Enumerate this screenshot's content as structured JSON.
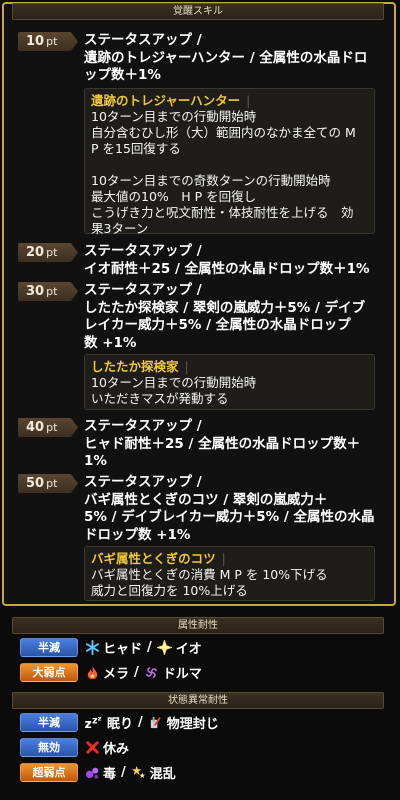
{
  "awakening": {
    "header": "覚醒スキル",
    "entries": [
      {
        "pt": "10",
        "unit": "pt",
        "text": "ステータスアップ /\n遺跡のトレジャーハンター / 全属性の水晶ドロ\nップ数＋1%"
      },
      {
        "pt": "20",
        "unit": "pt",
        "text": "ステータスアップ /\nイオ耐性＋25 / 全属性の水晶ドロップ数＋1%"
      },
      {
        "pt": "30",
        "unit": "pt",
        "text": "ステータスアップ /\nしたたか探検家 / 翠剣の嵐威力＋5% / デイブ\nレイカー威力＋5% / 全属性の水晶ドロップ\n数 +1%"
      },
      {
        "pt": "40",
        "unit": "pt",
        "text": "ステータスアップ /\nヒャド耐性＋25 / 全属性の水晶ドロップ数＋\n1%"
      },
      {
        "pt": "50",
        "unit": "pt",
        "text": "ステータスアップ /\nバギ属性とくぎのコツ / 翠剣の嵐威力＋\n5% / デイブレイカー威力＋5% / 全属性の水晶\nドロップ数 +1%"
      }
    ],
    "details": [
      {
        "title": "遺跡のトレジャーハンター",
        "lines": [
          "10ターン目までの行動開始時",
          "自分含むひし形（大）範囲内のなかま全ての M",
          "P を15回復する",
          "",
          "10ターン目までの奇数ターンの行動開始時",
          "最大値の10%　H P を回復し",
          "こうげき力と呪文耐性・体技耐性を上げる　効",
          "果3ターン"
        ]
      },
      {
        "title": "したたか探検家",
        "lines": [
          "10ターン目までの行動開始時",
          "いただきマスが発動する"
        ]
      },
      {
        "title": "バギ属性とくぎのコツ",
        "lines": [
          "バギ属性とくぎの消費 M P を 10%下げる",
          "威力と回復力を 10%上げる"
        ]
      }
    ]
  },
  "resistances": {
    "header": "属性耐性",
    "rows": [
      {
        "tag": "半減",
        "tag_color": "#2f5fb8",
        "items": [
          {
            "icon": "ice-snowflake-icon",
            "label": "ヒャド"
          },
          {
            "icon": "explosion-icon",
            "label": "イオ"
          }
        ]
      },
      {
        "tag": "大弱点",
        "tag_color": "#d06a16",
        "items": [
          {
            "icon": "flame-icon",
            "label": "メラ"
          },
          {
            "icon": "dark-swirl-icon",
            "label": "ドルマ"
          }
        ]
      }
    ]
  },
  "status": {
    "header": "状態異常耐性",
    "rows": [
      {
        "tag": "半減",
        "tag_color": "#2f5fb8",
        "items": [
          {
            "icon": "sleep-zz-icon",
            "label": "眠り"
          },
          {
            "icon": "seal-icon",
            "label": "物理封じ"
          }
        ]
      },
      {
        "tag": "無効",
        "tag_color": "#2f5fb8",
        "items": [
          {
            "icon": "red-x-icon",
            "label": "休み"
          }
        ]
      },
      {
        "tag": "超弱点",
        "tag_color": "#d06a16",
        "items": [
          {
            "icon": "poison-bubbles-icon",
            "label": "毒"
          },
          {
            "icon": "confusion-stars-icon",
            "label": "混乱"
          }
        ]
      }
    ]
  }
}
